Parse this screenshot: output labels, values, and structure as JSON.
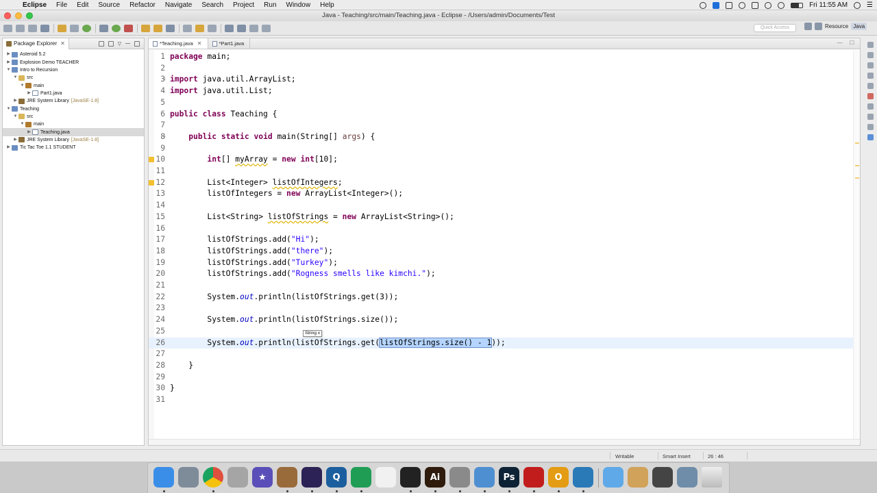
{
  "menubar": {
    "app_name": "Eclipse",
    "items": [
      "File",
      "Edit",
      "Source",
      "Refactor",
      "Navigate",
      "Search",
      "Project",
      "Run",
      "Window",
      "Help"
    ],
    "clock": "Fri 11:55 AM"
  },
  "window": {
    "title": "Java - Teaching/src/main/Teaching.java - Eclipse - /Users/admin/Documents/Test"
  },
  "toolbar": {
    "quick_access": "Quick Access",
    "perspective": "Resource",
    "perspective_java": "Java"
  },
  "explorer": {
    "title": "Package Explorer",
    "tree": [
      {
        "label": "Asteroid 5.2",
        "depth": 0,
        "icon": "project-icon",
        "expanded": false
      },
      {
        "label": "Explosion Demo TEACHER",
        "depth": 0,
        "icon": "project-icon",
        "expanded": false
      },
      {
        "label": "Intro to Recursion",
        "depth": 0,
        "icon": "project-icon",
        "expanded": true
      },
      {
        "label": "src",
        "depth": 1,
        "icon": "source-folder-icon",
        "expanded": true
      },
      {
        "label": "main",
        "depth": 2,
        "icon": "package-icon",
        "expanded": true
      },
      {
        "label": "Part1.java",
        "depth": 3,
        "icon": "java-file-icon",
        "expanded": false
      },
      {
        "label": "JRE System Library",
        "suffix": "[JavaSE-1.8]",
        "depth": 1,
        "icon": "library-icon",
        "expanded": false
      },
      {
        "label": "Teaching",
        "depth": 0,
        "icon": "project-icon",
        "expanded": true
      },
      {
        "label": "src",
        "depth": 1,
        "icon": "source-folder-icon",
        "expanded": true
      },
      {
        "label": "main",
        "depth": 2,
        "icon": "package-icon",
        "expanded": true
      },
      {
        "label": "Teaching.java",
        "depth": 3,
        "icon": "java-file-icon",
        "expanded": false,
        "selected": true
      },
      {
        "label": "JRE System Library",
        "suffix": "[JavaSE-1.8]",
        "depth": 1,
        "icon": "library-icon",
        "expanded": false
      },
      {
        "label": "Tic Tac Toe 1.1 STUDENT",
        "depth": 0,
        "icon": "project-icon",
        "expanded": false
      }
    ]
  },
  "editor": {
    "tabs": [
      {
        "label": "*Teaching.java",
        "active": true
      },
      {
        "label": "*Part1.java",
        "active": false
      }
    ],
    "param_hint": "String x",
    "current_line": 26,
    "lines": [
      [
        {
          "t": "package",
          "c": "kw"
        },
        {
          "t": " main;"
        }
      ],
      [],
      [
        {
          "t": "import",
          "c": "kw"
        },
        {
          "t": " java.util.ArrayList;"
        }
      ],
      [
        {
          "t": "import",
          "c": "kw"
        },
        {
          "t": " java.util.List;"
        }
      ],
      [],
      [
        {
          "t": "public",
          "c": "kw"
        },
        {
          "t": " "
        },
        {
          "t": "class",
          "c": "kw"
        },
        {
          "t": " Teaching {"
        }
      ],
      [],
      [
        {
          "t": "    "
        },
        {
          "t": "public",
          "c": "kw"
        },
        {
          "t": " "
        },
        {
          "t": "static",
          "c": "kw"
        },
        {
          "t": " "
        },
        {
          "t": "void",
          "c": "kw"
        },
        {
          "t": " main(String[] "
        },
        {
          "t": "args",
          "c": "par"
        },
        {
          "t": ") {"
        }
      ],
      [],
      [
        {
          "t": "        "
        },
        {
          "t": "int",
          "c": "kw"
        },
        {
          "t": "[] "
        },
        {
          "t": "myArray",
          "c": "warn"
        },
        {
          "t": " = "
        },
        {
          "t": "new",
          "c": "kw"
        },
        {
          "t": " "
        },
        {
          "t": "int",
          "c": "kw"
        },
        {
          "t": "[10];"
        }
      ],
      [],
      [
        {
          "t": "        List<Integer> "
        },
        {
          "t": "listOfIntegers",
          "c": "warn"
        },
        {
          "t": ";"
        }
      ],
      [
        {
          "t": "        listOfIntegers = "
        },
        {
          "t": "new",
          "c": "kw"
        },
        {
          "t": " ArrayList<Integer>();"
        }
      ],
      [],
      [
        {
          "t": "        List<String> "
        },
        {
          "t": "listOfStrings",
          "c": "warn"
        },
        {
          "t": " = "
        },
        {
          "t": "new",
          "c": "kw"
        },
        {
          "t": " ArrayList<String>();"
        }
      ],
      [],
      [
        {
          "t": "        listOfStrings.add("
        },
        {
          "t": "\"Hi\"",
          "c": "str"
        },
        {
          "t": ");"
        }
      ],
      [
        {
          "t": "        listOfStrings.add("
        },
        {
          "t": "\"there\"",
          "c": "str"
        },
        {
          "t": ");"
        }
      ],
      [
        {
          "t": "        listOfStrings.add("
        },
        {
          "t": "\"Turkey\"",
          "c": "str"
        },
        {
          "t": ");"
        }
      ],
      [
        {
          "t": "        listOfStrings.add("
        },
        {
          "t": "\"Rogness smells like kimchi.\"",
          "c": "str"
        },
        {
          "t": ");"
        }
      ],
      [],
      [
        {
          "t": "        System."
        },
        {
          "t": "out",
          "c": "fld"
        },
        {
          "t": ".println(listOfStrings.get(3));"
        }
      ],
      [],
      [
        {
          "t": "        System."
        },
        {
          "t": "out",
          "c": "fld"
        },
        {
          "t": ".println(listOfStrings.size());"
        }
      ],
      [],
      [
        {
          "t": "        System."
        },
        {
          "t": "out",
          "c": "fld"
        },
        {
          "t": ".println(listOfStrings.get("
        },
        {
          "t": "listOfStrings.size() - 1",
          "c": "sel"
        },
        {
          "t": "));"
        }
      ],
      [],
      [
        {
          "t": "    }"
        }
      ],
      [],
      [
        {
          "t": "}"
        }
      ],
      []
    ],
    "warning_lines": [
      10,
      12
    ],
    "fold_lines": [
      3,
      8
    ]
  },
  "statusbar": {
    "mode": "Writable",
    "insert": "Smart Insert",
    "position": "26 : 46"
  },
  "dock": {
    "apps": [
      {
        "name": "finder-icon",
        "color": "#3b8ee8",
        "glyph": ""
      },
      {
        "name": "launchpad-icon",
        "color": "#7e8b99",
        "glyph": ""
      },
      {
        "name": "chrome-icon",
        "color": "#e0503f",
        "glyph": ""
      },
      {
        "name": "notes-icon",
        "color": "#a5a5a5",
        "glyph": ""
      },
      {
        "name": "imovie-icon",
        "color": "#5a4fb8",
        "glyph": "★"
      },
      {
        "name": "instruments-icon",
        "color": "#9a6b3a",
        "glyph": ""
      },
      {
        "name": "eclipse-icon",
        "color": "#2c2255",
        "glyph": ""
      },
      {
        "name": "quicktime-icon",
        "color": "#1c5f9e",
        "glyph": "Q"
      },
      {
        "name": "hangouts-icon",
        "color": "#1f9d55",
        "glyph": ""
      },
      {
        "name": "apps-grid-icon",
        "color": "#f1f1f1",
        "glyph": ""
      },
      {
        "name": "activity-monitor-icon",
        "color": "#222",
        "glyph": ""
      },
      {
        "name": "illustrator-icon",
        "color": "#2e1b0c",
        "glyph": "Ai"
      },
      {
        "name": "xcode-tools-icon",
        "color": "#8a8a8a",
        "glyph": ""
      },
      {
        "name": "textedit-icon",
        "color": "#4e8fd1",
        "glyph": ""
      },
      {
        "name": "photoshop-icon",
        "color": "#0e2235",
        "glyph": "Ps"
      },
      {
        "name": "acrobat-icon",
        "color": "#c21d1d",
        "glyph": ""
      },
      {
        "name": "outlook-icon",
        "color": "#e39c13",
        "glyph": "O"
      },
      {
        "name": "window-app-icon",
        "color": "#2a7ab8",
        "glyph": ""
      },
      {
        "name": "applications-folder-icon",
        "color": "#5fa9e8",
        "glyph": ""
      },
      {
        "name": "package-icon",
        "color": "#d1a25a",
        "glyph": ""
      },
      {
        "name": "terminal-icon",
        "color": "#444",
        "glyph": ""
      },
      {
        "name": "screenshot-icon",
        "color": "#6f8da8",
        "glyph": ""
      },
      {
        "name": "trash-icon",
        "color": "#c9c9c9",
        "glyph": ""
      }
    ]
  }
}
